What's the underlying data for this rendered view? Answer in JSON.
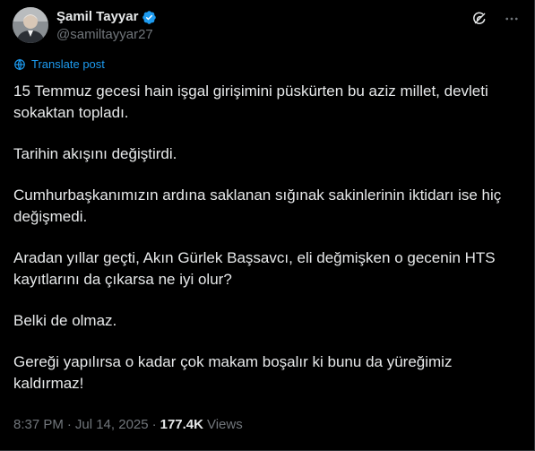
{
  "author": {
    "display_name": "Şamil Tayyar",
    "handle": "@samiltayyar27",
    "verified": true
  },
  "translate_label": "Translate post",
  "paragraphs": [
    "15 Temmuz gecesi hain işgal girişimini püskürten bu aziz millet, devleti sokaktan topladı.",
    "Tarihin akışını değiştirdi.",
    "Cumhurbaşkanımızın ardına saklanan sığınak sakinlerinin iktidarı ise hiç değişmedi.",
    "Aradan yıllar geçti, Akın Gürlek Başsavcı, eli değmişken o gecenin HTS kayıtlarını da çıkarsa ne iyi olur?",
    "Belki de olmaz.",
    "Gereği yapılırsa o kadar çok makam boşalır ki bunu da yüreğimiz kaldırmaz!"
  ],
  "meta": {
    "time": "8:37 PM",
    "separator": "·",
    "date": "Jul 14, 2025",
    "views_count": "177.4K",
    "views_label": "Views"
  },
  "colors": {
    "background": "#000000",
    "text": "#e7e9ea",
    "muted": "#71767b",
    "accent": "#1d9bf0",
    "verified": "#1d9bf0"
  },
  "icons": {
    "verified": "verified-badge-icon",
    "grok": "grok-icon",
    "more": "more-icon",
    "translate": "translate-icon"
  }
}
